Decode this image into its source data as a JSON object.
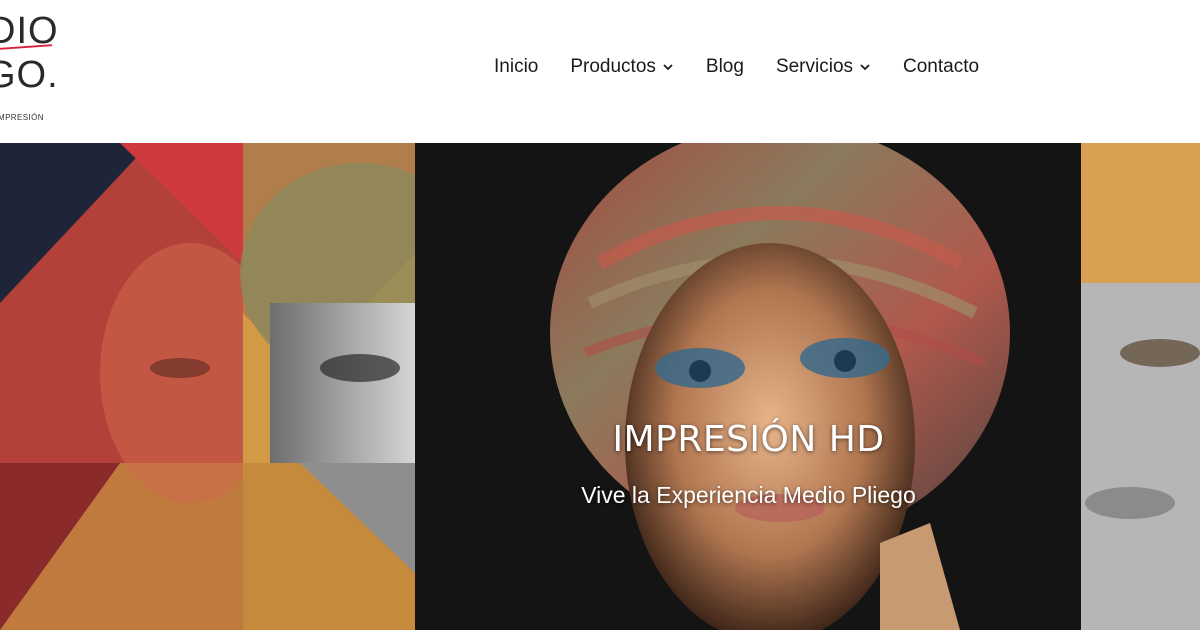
{
  "logo": {
    "line1": "DIO",
    "line2": "GO.",
    "tagline": "MPRESIÓN"
  },
  "nav": {
    "items": [
      {
        "label": "Inicio",
        "dropdown": false
      },
      {
        "label": "Productos",
        "dropdown": true
      },
      {
        "label": "Blog",
        "dropdown": false
      },
      {
        "label": "Servicios",
        "dropdown": true
      },
      {
        "label": "Contacto",
        "dropdown": false
      }
    ]
  },
  "hero": {
    "title": "IMPRESIÓN HD",
    "subtitle": "Vive la Experiencia Medio Pliego"
  },
  "colors": {
    "accent_red": "#d8213b",
    "hero_bg": "#151515",
    "nav_text": "#1b1b1b"
  }
}
